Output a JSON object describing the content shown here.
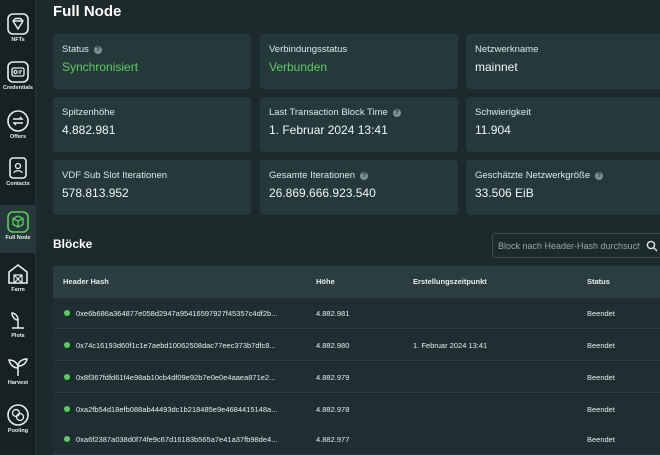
{
  "sidebar": {
    "items": [
      {
        "label": "NFTs",
        "icon": "diamond-icon"
      },
      {
        "label": "Credentials",
        "icon": "id-card-icon"
      },
      {
        "label": "Offers",
        "icon": "swap-icon"
      },
      {
        "label": "Contacts",
        "icon": "contact-book-icon"
      },
      {
        "label": "Full Node",
        "icon": "cube-icon",
        "active": true
      },
      {
        "label": "Farm",
        "icon": "barn-icon"
      },
      {
        "label": "Plots",
        "icon": "sprout-icon"
      },
      {
        "label": "Harvest",
        "icon": "plant-icon"
      },
      {
        "label": "Pooling",
        "icon": "pool-icon"
      }
    ]
  },
  "page": {
    "title": "Full Node"
  },
  "cards": [
    {
      "key": "Status",
      "value": "Synchronisiert",
      "help": true,
      "green": true
    },
    {
      "key": "Verbindungsstatus",
      "value": "Verbunden",
      "help": false,
      "green": true
    },
    {
      "key": "Netzwerkname",
      "value": "mainnet",
      "help": false
    },
    {
      "key": "Spitzenhöhe",
      "value": "4.882.981",
      "help": false
    },
    {
      "key": "Last Transaction Block Time",
      "value": "1. Februar 2024 13:41",
      "help": true
    },
    {
      "key": "Schwierigkeit",
      "value": "11.904",
      "help": false
    },
    {
      "key": "VDF Sub Slot Iterationen",
      "value": "578.813.952",
      "help": false
    },
    {
      "key": "Gesamte Iterationen",
      "value": "26.869.666.923.540",
      "help": true
    },
    {
      "key": "Geschätzte Netzwerkgröße",
      "value": "33.506 EiB",
      "help": true
    }
  ],
  "blocks": {
    "title": "Blöcke",
    "search_placeholder": "Block nach Header-Hash durchsuchen",
    "columns": [
      "Header Hash",
      "Höhe",
      "Erstellungszeitpunkt",
      "Status"
    ],
    "rows": [
      {
        "hash": "0xe6b686a364877e058d2947a95416597927f45357c4df2b...",
        "height": "4.882.981",
        "time": "",
        "status": "Beendet"
      },
      {
        "hash": "0x74c16193d60f1c1e7aebd10062508dac77eec373b7dfc8...",
        "height": "4.882.980",
        "time": "1. Februar 2024 13:41",
        "status": "Beendet"
      },
      {
        "hash": "0x8f367fdfd61f4e98ab10cb4df09e92b7e0e0e4aaea871e2...",
        "height": "4.882.979",
        "time": "",
        "status": "Beendet"
      },
      {
        "hash": "0xa2fb54d18efb088ab44493dc1b218485e9e4684415148a...",
        "height": "4.882.978",
        "time": "",
        "status": "Beendet"
      },
      {
        "hash": "0xa6f2387a038d0f74fe9c67d16183b565a7e41a37fb98de4...",
        "height": "4.882.977",
        "time": "",
        "status": "Beendet"
      }
    ]
  },
  "colors": {
    "accent": "#5ecc62",
    "background": "#1c2a2b",
    "card": "#25393a"
  }
}
